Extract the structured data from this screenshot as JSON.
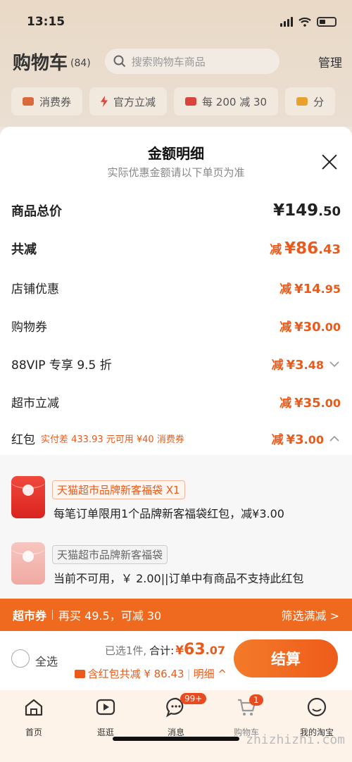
{
  "status_bar": {
    "time": "13:15"
  },
  "cart_header": {
    "title": "购物车",
    "count": "(84)",
    "search_placeholder": "搜索购物车商品",
    "manage": "管理"
  },
  "chips": [
    {
      "label": "消费券",
      "icon": "ticket-icon"
    },
    {
      "label": "官方立减",
      "icon": "bolt-icon"
    },
    {
      "label": "每 200 减 30",
      "icon": "bag-icon"
    },
    {
      "label": "分",
      "icon": "folder-icon"
    }
  ],
  "sheet": {
    "title": "金额明细",
    "subtitle": "实际优惠金额请以下单页为准",
    "rows": [
      {
        "label": "商品总价",
        "prefix": "",
        "currency": "¥",
        "int": "149",
        "dec": ".50"
      },
      {
        "label": "共减",
        "prefix": "减",
        "currency": "¥",
        "int": "86",
        "dec": ".43"
      },
      {
        "label": "店铺优惠",
        "prefix": "减",
        "currency": "¥",
        "int": "14",
        "dec": ".95"
      },
      {
        "label": "购物券",
        "prefix": "减",
        "currency": "¥",
        "int": "30",
        "dec": ".00"
      },
      {
        "label": "88VIP 专享 9.5 折",
        "prefix": "减",
        "currency": "¥",
        "int": "3",
        "dec": ".48"
      },
      {
        "label": "超市立减",
        "prefix": "减",
        "currency": "¥",
        "int": "35",
        "dec": ".00"
      },
      {
        "label": "红包",
        "hint": "实付差 433.93 元可用 ¥40 消费券",
        "prefix": "减",
        "currency": "¥",
        "int": "3",
        "dec": ".00"
      }
    ],
    "packets": [
      {
        "title": "天猫超市品牌新客福袋 X1",
        "desc": "每笔订单限用1个品牌新客福袋红包，减¥3.00"
      },
      {
        "title": "天猫超市品牌新客福袋",
        "desc": "当前不可用，￥ 2.00||订单中有商品不支持此红包"
      }
    ]
  },
  "promo_bar": {
    "tag": "超市券",
    "text": "再买 49.5，可减 30",
    "action": "筛选满减 >"
  },
  "checkout": {
    "select_all": "全选",
    "selected": "已选1件,",
    "total_label": "合计:",
    "currency": "¥",
    "total_int": "63",
    "total_dec": ".07",
    "discount_text": "含红包共减 ¥ 86.43",
    "detail": "明细 ^",
    "pay_button": "结算"
  },
  "tabbar": [
    {
      "label": "首页",
      "icon": "home-icon"
    },
    {
      "label": "逛逛",
      "icon": "play-icon"
    },
    {
      "label": "消息",
      "icon": "message-icon",
      "badge": "99+"
    },
    {
      "label": "购物车",
      "icon": "cart-icon",
      "badge": "1"
    },
    {
      "label": "我的淘宝",
      "icon": "profile-icon"
    }
  ],
  "watermark": "zhizhizhi.com",
  "colors": {
    "accent": "#EA5A1B",
    "promo_bar": "#EF6A1E",
    "sheet_bg": "#FFFFFF"
  }
}
